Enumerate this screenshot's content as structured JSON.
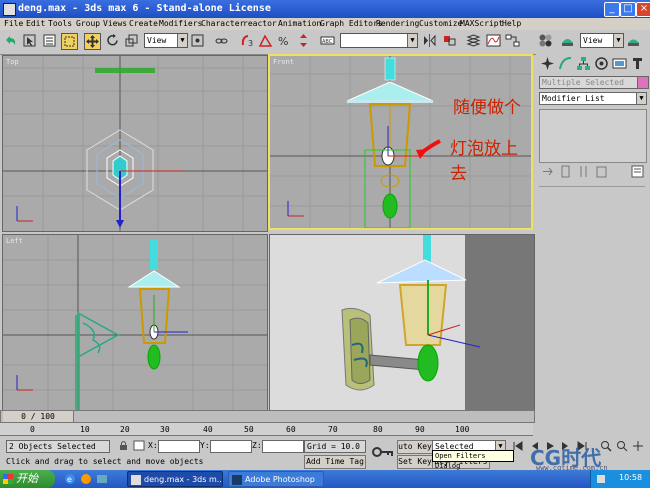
{
  "window": {
    "title": "deng.max - 3ds max 6 - Stand-alone License"
  },
  "menu": [
    "File",
    "Edit",
    "Tools",
    "Group",
    "Views",
    "Create",
    "Modifiers",
    "Character",
    "reactor",
    "Animation",
    "Graph Editors",
    "Rendering",
    "Customize",
    "MAXScript",
    "Help"
  ],
  "toolbar": {
    "view_combo_1": "View",
    "view_combo_2": "View",
    "selection_set": ""
  },
  "viewports": {
    "top": {
      "label": "Top"
    },
    "front": {
      "label": "Front"
    },
    "left": {
      "label": "Left"
    },
    "perspective": {
      "label": ""
    }
  },
  "annotations": {
    "note1": "随便做个",
    "note2": "灯泡放上去"
  },
  "command_panel": {
    "selection_label": "Multiple Selected",
    "modifier_list": "Modifier List"
  },
  "timeline": {
    "frame_counter": "0 / 100",
    "ticks": [
      "0",
      "10",
      "20",
      "30",
      "40",
      "50",
      "60",
      "70",
      "80",
      "90",
      "100"
    ]
  },
  "status": {
    "objects_selected": "2 Objects Selected",
    "prompt": "Click and drag to select and move objects",
    "x_label": "X:",
    "y_label": "Y:",
    "z_label": "Z:",
    "grid": "Grid = 10.0",
    "add_time_tag": "Add Time Tag",
    "auto_key": "uto Key",
    "set_key": "Set Key",
    "key_filters": "Key Filters",
    "selected_combo": "Selected",
    "tooltip": "Open Filters Dialog"
  },
  "taskbar": {
    "start": "开始",
    "task1": "deng.max - 3ds m...",
    "task2": "Adobe Photoshop",
    "clock": "10:58"
  },
  "watermark": {
    "brand": "CG时代",
    "url": "www.cgtime.com.cn"
  }
}
